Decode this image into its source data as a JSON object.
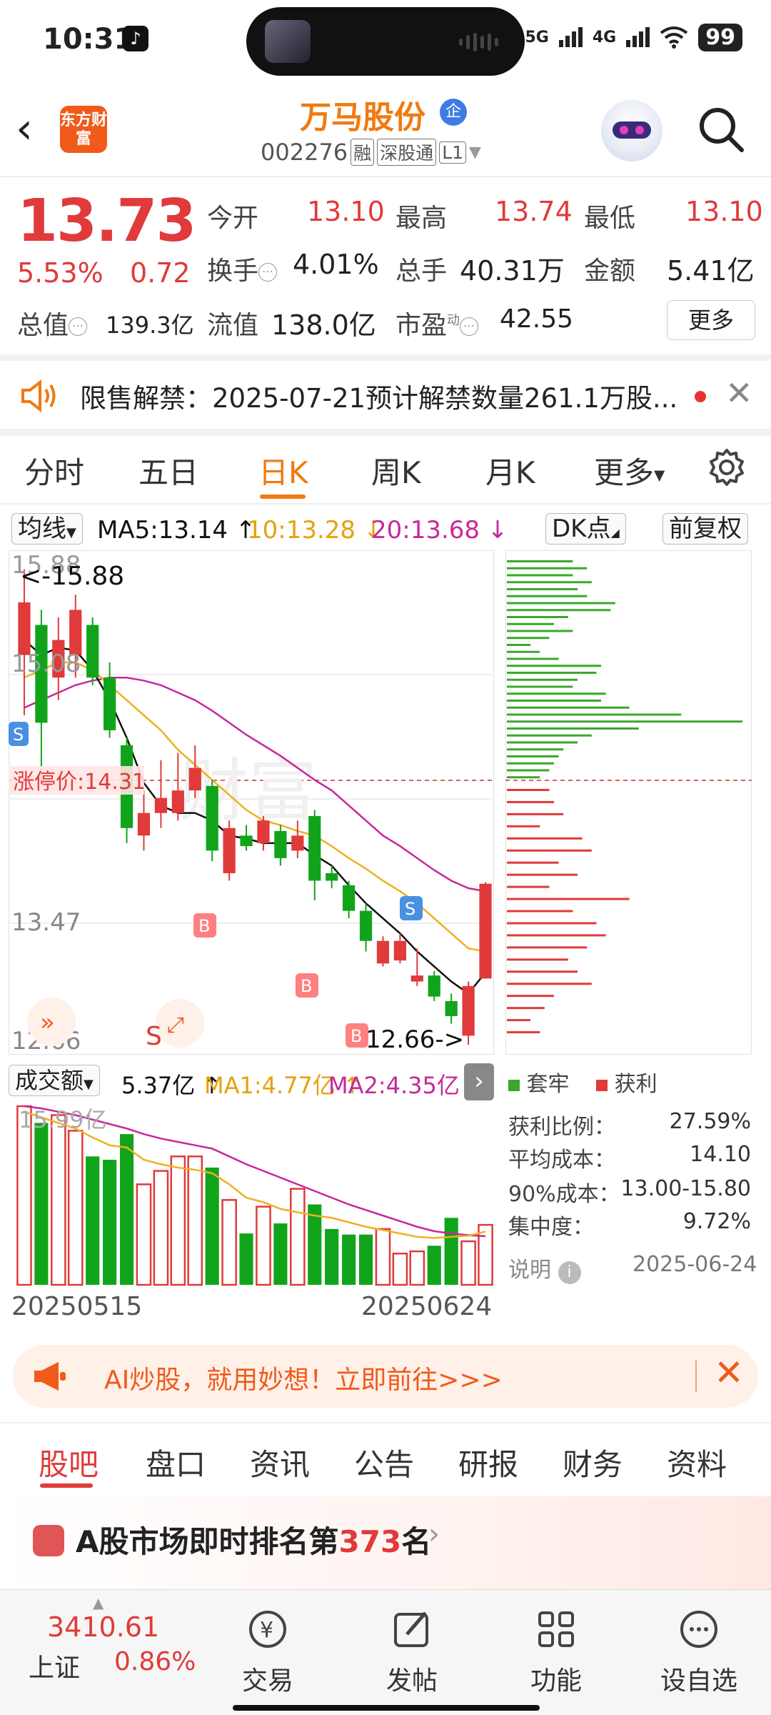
{
  "status_bar": {
    "time": "10:31",
    "signal1": "5G",
    "signal2": "4G",
    "battery": "99"
  },
  "header": {
    "back_icon": "chevron-left-icon",
    "logo_text": "东方财富",
    "stock_name": "万马股份",
    "badge": "企",
    "code": "002276",
    "tags": [
      "融",
      "深股通",
      "L1"
    ],
    "search_icon": "search-icon"
  },
  "quote": {
    "price": "13.73",
    "change_pct": "5.53%",
    "change_amt": "0.72",
    "open_label": "今开",
    "open": "13.10",
    "high_label": "最高",
    "high": "13.74",
    "low_label": "最低",
    "low": "13.10",
    "turnover_label": "换手",
    "turnover": "4.01%",
    "volume_label": "总手",
    "volume": "40.31万",
    "amount_label": "金额",
    "amount": "5.41亿",
    "mktcap_label": "总值",
    "mktcap": "139.3亿",
    "float_label": "流值",
    "float": "138.0亿",
    "pe_label": "市盈",
    "pe_sup": "动",
    "pe": "42.55",
    "more": "更多"
  },
  "notice": {
    "text": "限售解禁：2025-07-21预计解禁数量261.1万股..."
  },
  "period_tabs": [
    "分时",
    "五日",
    "日K",
    "周K",
    "月K",
    "更多"
  ],
  "active_period": "日K",
  "ma_bar": {
    "selector": "均线",
    "ma5": "MA5:13.14 ↑",
    "ma10": "10:13.28 ↓",
    "ma20": "20:13.68 ↓",
    "dk": "DK点",
    "fq": "前复权"
  },
  "chart_labels": {
    "top_price": "15.88",
    "top_marker": "<-15.88",
    "mid_price": "15.08",
    "limit_label": "涨停价:14.31",
    "low_mid": "13.47",
    "bottom_price": "12.66",
    "bottom_marker": "12.66->"
  },
  "chart_data": {
    "type": "candlestick",
    "ylim": [
      12.66,
      15.88
    ],
    "candles": [
      {
        "o": 15.25,
        "c": 15.6,
        "h": 15.82,
        "l": 14.85
      },
      {
        "o": 15.45,
        "c": 14.8,
        "h": 15.55,
        "l": 14.4
      },
      {
        "o": 15.1,
        "c": 15.35,
        "h": 15.5,
        "l": 14.95
      },
      {
        "o": 15.25,
        "c": 15.55,
        "h": 15.65,
        "l": 15.1
      },
      {
        "o": 15.45,
        "c": 15.1,
        "h": 15.5,
        "l": 15.05
      },
      {
        "o": 15.1,
        "c": 14.75,
        "h": 15.2,
        "l": 14.7
      },
      {
        "o": 14.65,
        "c": 14.1,
        "h": 14.7,
        "l": 14.0
      },
      {
        "o": 14.05,
        "c": 14.2,
        "h": 14.35,
        "l": 13.95
      },
      {
        "o": 14.2,
        "c": 14.3,
        "h": 14.55,
        "l": 14.1
      },
      {
        "o": 14.2,
        "c": 14.35,
        "h": 14.6,
        "l": 14.15
      },
      {
        "o": 14.35,
        "c": 14.5,
        "h": 14.65,
        "l": 14.3
      },
      {
        "o": 14.38,
        "c": 13.95,
        "h": 14.42,
        "l": 13.88
      },
      {
        "o": 13.8,
        "c": 14.1,
        "h": 14.15,
        "l": 13.75
      },
      {
        "o": 14.05,
        "c": 13.98,
        "h": 14.12,
        "l": 13.95
      },
      {
        "o": 14.0,
        "c": 14.15,
        "h": 14.18,
        "l": 13.95
      },
      {
        "o": 14.08,
        "c": 13.9,
        "h": 14.12,
        "l": 13.85
      },
      {
        "o": 13.95,
        "c": 14.05,
        "h": 14.15,
        "l": 13.9
      },
      {
        "o": 14.18,
        "c": 13.75,
        "h": 14.22,
        "l": 13.62
      },
      {
        "o": 13.8,
        "c": 13.75,
        "h": 13.85,
        "l": 13.7
      },
      {
        "o": 13.72,
        "c": 13.55,
        "h": 13.75,
        "l": 13.5
      },
      {
        "o": 13.55,
        "c": 13.35,
        "h": 13.6,
        "l": 13.28
      },
      {
        "o": 13.2,
        "c": 13.35,
        "h": 13.38,
        "l": 13.18
      },
      {
        "o": 13.22,
        "c": 13.35,
        "h": 13.4,
        "l": 13.2
      },
      {
        "o": 13.08,
        "c": 13.12,
        "h": 13.3,
        "l": 13.05
      },
      {
        "o": 13.12,
        "c": 12.98,
        "h": 13.15,
        "l": 12.95
      },
      {
        "o": 12.95,
        "c": 12.85,
        "h": 13.0,
        "l": 12.8
      },
      {
        "o": 12.72,
        "c": 13.05,
        "h": 13.08,
        "l": 12.66
      },
      {
        "o": 13.1,
        "c": 13.73,
        "h": 13.74,
        "l": 13.1
      }
    ],
    "ma5": [
      15.35,
      15.25,
      15.3,
      15.28,
      15.15,
      14.95,
      14.7,
      14.4,
      14.25,
      14.2,
      14.2,
      14.15,
      14.05,
      14.03,
      14.0,
      14.0,
      14.0,
      13.92,
      13.85,
      13.72,
      13.6,
      13.5,
      13.4,
      13.28,
      13.18,
      13.08,
      13.0,
      13.14
    ],
    "ma10": [
      15.1,
      15.15,
      15.2,
      15.2,
      15.15,
      15.05,
      14.95,
      14.85,
      14.75,
      14.62,
      14.52,
      14.42,
      14.32,
      14.22,
      14.15,
      14.12,
      14.08,
      14.05,
      13.98,
      13.9,
      13.83,
      13.75,
      13.68,
      13.6,
      13.5,
      13.4,
      13.3,
      13.28
    ],
    "ma20": [
      14.9,
      14.95,
      15.0,
      15.05,
      15.08,
      15.1,
      15.1,
      15.08,
      15.05,
      15.0,
      14.95,
      14.88,
      14.8,
      14.72,
      14.65,
      14.58,
      14.5,
      14.42,
      14.35,
      14.25,
      14.15,
      14.05,
      13.98,
      13.9,
      13.82,
      13.75,
      13.7,
      13.68
    ],
    "chip_ylim": [
      12.66,
      15.88
    ],
    "chip_profit": [
      0.18,
      0.2,
      0.24,
      0.14,
      0.32,
      0.36,
      0.22,
      0.3,
      0.18,
      0.52,
      0.28,
      0.38,
      0.42,
      0.34,
      0.26,
      0.3,
      0.36,
      0.2,
      0.16,
      0.1,
      0.14
    ],
    "chip_hold": [
      0.28,
      0.34,
      0.28,
      0.36,
      0.3,
      0.34,
      0.46,
      0.44,
      0.26,
      0.2,
      0.28,
      0.18,
      0.1,
      0.14,
      0.22,
      0.4,
      0.38,
      0.3,
      0.28,
      0.42,
      0.4,
      0.52,
      0.74,
      1.0,
      0.56,
      0.36,
      0.3,
      0.24,
      0.22,
      0.2,
      0.18,
      0.14
    ],
    "volume": [
      16.0,
      14.5,
      15.2,
      13.8,
      11.5,
      11.2,
      13.5,
      9.0,
      10.2,
      11.5,
      11.5,
      10.5,
      7.6,
      4.6,
      7.0,
      5.5,
      8.6,
      7.2,
      5.0,
      4.5,
      4.5,
      5.0,
      2.8,
      3.0,
      3.5,
      6.0,
      3.9,
      5.37
    ],
    "ma_vol1": [
      15.5,
      15.0,
      14.5,
      14.0,
      13.2,
      12.5,
      12.3,
      11.2,
      10.8,
      10.5,
      10.3,
      10.0,
      9.0,
      7.8,
      7.4,
      6.8,
      6.5,
      6.2,
      6.0,
      5.6,
      5.2,
      4.9,
      4.6,
      4.3,
      4.2,
      4.3,
      4.4,
      4.77
    ],
    "ma_vol2": [
      16.0,
      15.8,
      15.5,
      15.2,
      14.8,
      14.4,
      14.0,
      13.5,
      13.1,
      12.8,
      12.5,
      12.2,
      11.5,
      10.8,
      10.2,
      9.6,
      9.0,
      8.4,
      7.8,
      7.2,
      6.7,
      6.2,
      5.7,
      5.2,
      4.8,
      4.6,
      4.45,
      4.35
    ],
    "vol_max": 16.0
  },
  "vol_bar": {
    "selector": "成交额",
    "value": "5.37亿 ↑",
    "ma1": "MA1:4.77亿 ↑",
    "ma2": "MA2:4.35亿 ↓",
    "top_label": "15.99亿"
  },
  "dates": {
    "start": "20250515",
    "end": "20250624"
  },
  "chip_panel": {
    "legend_hold": "套牢",
    "legend_profit": "获利",
    "rows": [
      {
        "label": "获利比例：",
        "value": "27.59%"
      },
      {
        "label": "平均成本：",
        "value": "14.10"
      },
      {
        "label": "90%成本：",
        "value": "13.00-15.80"
      },
      {
        "label": "集中度：",
        "value": "9.72%"
      }
    ],
    "note": "说明",
    "date": "2025-06-24"
  },
  "ai_banner": {
    "text": "AI炒股，就用妙想！立即前往>>>"
  },
  "section_tabs": [
    "股吧",
    "盘口",
    "资讯",
    "公告",
    "研报",
    "财务",
    "资料"
  ],
  "rank": {
    "prefix": "A股市场即时排名第",
    "number": "373",
    "suffix": "名"
  },
  "bottom_nav": {
    "index_value": "3410.61",
    "index_name": "上证",
    "index_change": "0.86%",
    "items": [
      "交易",
      "发帖",
      "功能",
      "设自选"
    ]
  },
  "colors": {
    "up": "#e03a3a",
    "down": "#11a41b",
    "accent": "#f07a10",
    "ma5": "#111111",
    "ma10": "#f0b020",
    "ma20": "#c8289a"
  }
}
